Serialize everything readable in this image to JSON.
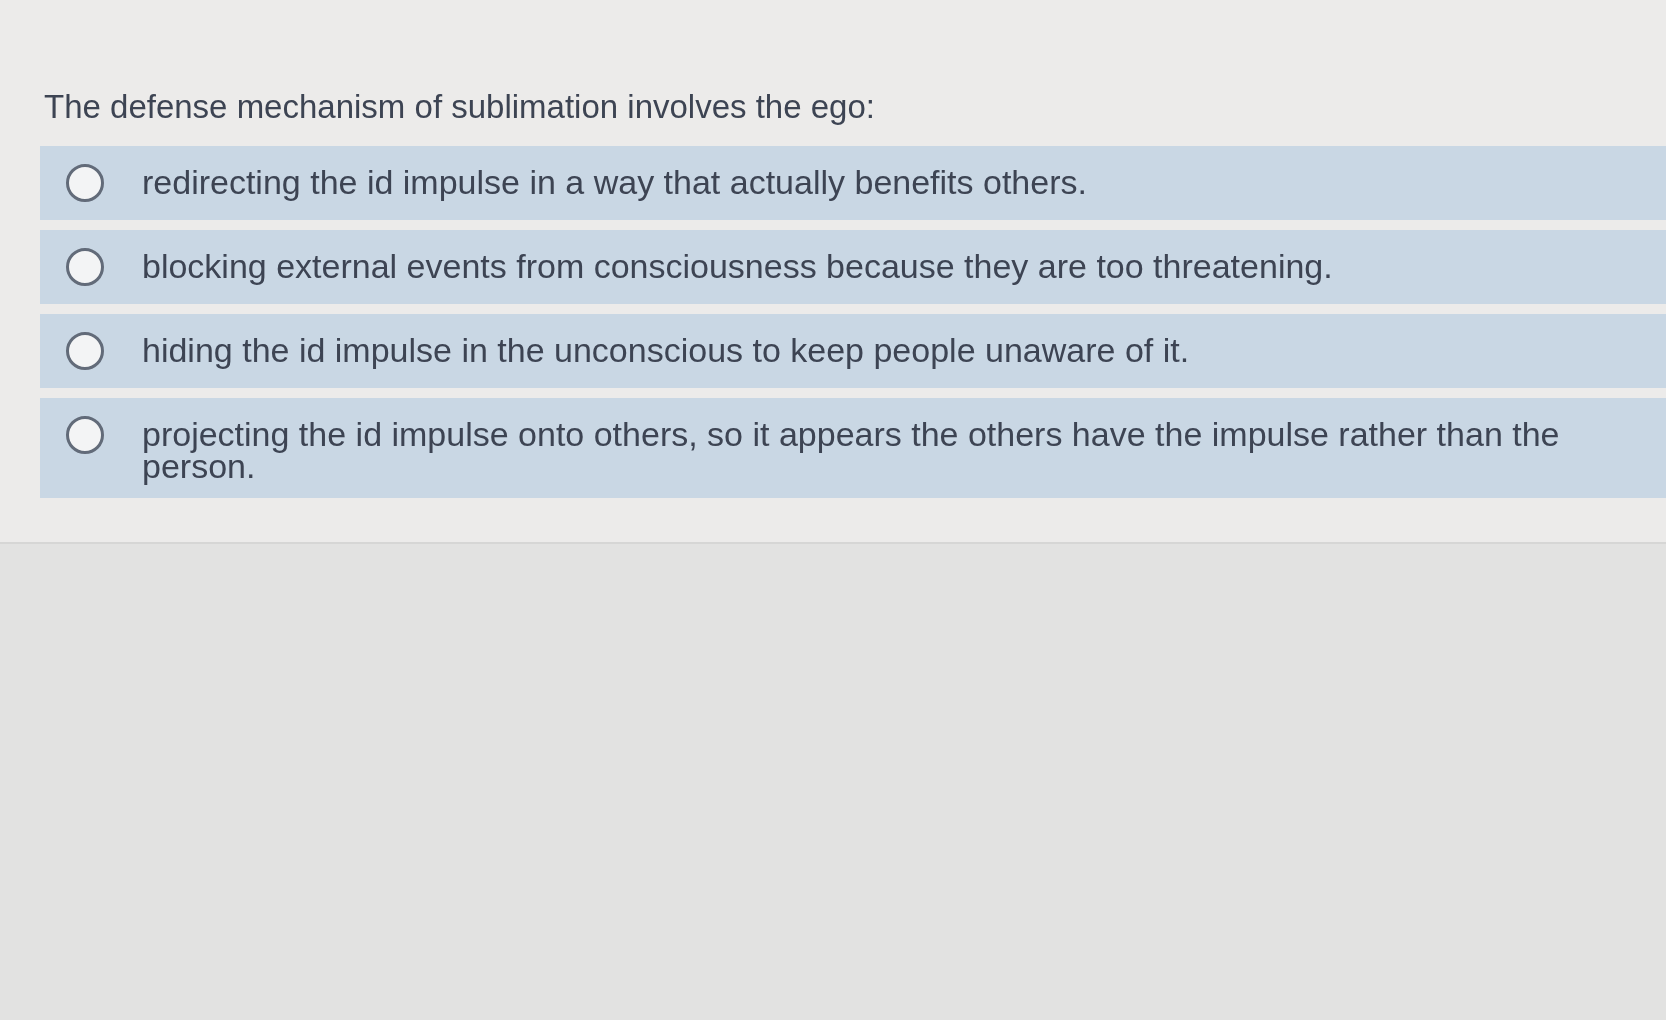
{
  "question": "The defense mechanism of sublimation involves the ego:",
  "options": [
    {
      "text": "redirecting the id impulse in a way that actually benefits others.",
      "selected": false
    },
    {
      "text": "blocking external events from consciousness because they are too threatening.",
      "selected": false
    },
    {
      "text": "hiding the id impulse in the unconscious to keep people unaware of it.",
      "selected": false
    },
    {
      "text": "projecting the id impulse onto others, so it appears the others have the impulse rather than the person.",
      "selected": false
    }
  ]
}
